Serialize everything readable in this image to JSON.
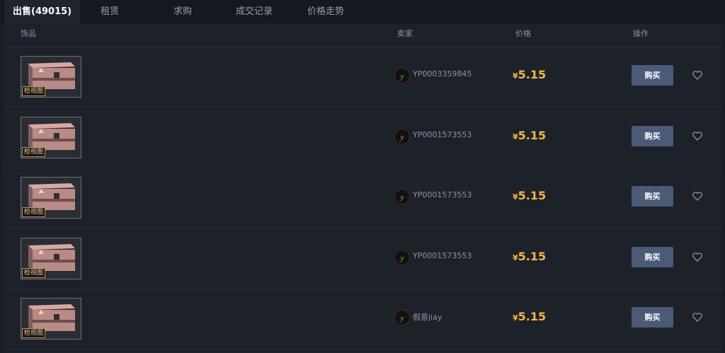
{
  "tabs": [
    {
      "label": "出售(49015)",
      "active": true
    },
    {
      "label": "租赁"
    },
    {
      "label": "求购"
    },
    {
      "label": "成交记录"
    },
    {
      "label": "价格走势"
    }
  ],
  "table": {
    "headers": {
      "item": "饰品",
      "seller": "卖家",
      "price": "价格",
      "action": "操作"
    },
    "rows": [
      {
        "thumb_label": "检视图",
        "seller": "YP0003359845",
        "currency": "¥",
        "price": "5.15",
        "buy": "购买"
      },
      {
        "thumb_label": "检视图",
        "seller": "YP0001573553",
        "currency": "¥",
        "price": "5.15",
        "buy": "购买"
      },
      {
        "thumb_label": "检视图",
        "seller": "YP0001573553",
        "currency": "¥",
        "price": "5.15",
        "buy": "购买"
      },
      {
        "thumb_label": "检视图",
        "seller": "YP0001573553",
        "currency": "¥",
        "price": "5.15",
        "buy": "购买"
      },
      {
        "thumb_label": "检视图",
        "seller": "假意jiay",
        "currency": "¥",
        "price": "5.15",
        "buy": "购买"
      }
    ]
  },
  "colors": {
    "background": "#1a1d24",
    "price": "#f2b84b",
    "buy_button": "#4a5a77",
    "crate": "#b98a86"
  },
  "icons": {
    "avatar": "seller-avatar-logo",
    "favorite": "heart-icon"
  }
}
